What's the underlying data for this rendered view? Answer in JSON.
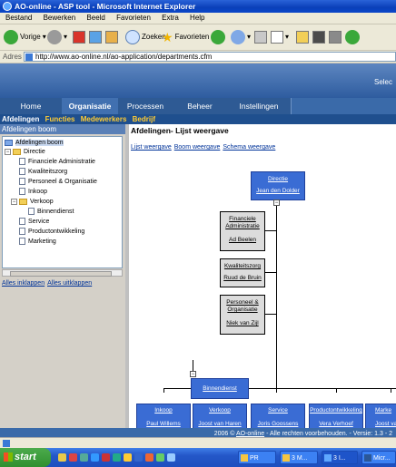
{
  "window": {
    "title": "AO-online - ASP tool - Microsoft Internet Explorer"
  },
  "menu": [
    "Bestand",
    "Bewerken",
    "Beeld",
    "Favorieten",
    "Extra",
    "Help"
  ],
  "toolbar": {
    "back": "Vorige",
    "search": "Zoeken",
    "favorites": "Favorieten"
  },
  "address": {
    "label": "Adres",
    "url": "http://www.ao-online.nl/ao-application/departments.cfm"
  },
  "banner": {
    "right_text": "Selec"
  },
  "nav": {
    "tabs": [
      "Home",
      "Organisatie",
      "Processen",
      "Beheer",
      "Instellingen"
    ],
    "active": "Organisatie"
  },
  "subnav": [
    "Afdelingen",
    "Functies",
    "Medewerkers",
    "Bedrijf"
  ],
  "left": {
    "heading": "Afdelingen boom",
    "tree": {
      "root": "Afdelingen boom",
      "directie": "Directie",
      "fin": "Financiele Administratie",
      "kwal": "Kwaliteitszorg",
      "po": "Personeel & Organisatie",
      "inkoop": "Inkoop",
      "verkoop": "Verkoop",
      "binnendienst": "Binnendienst",
      "service": "Service",
      "productontwikkeling": "Productontwikkeling",
      "marketing": "Marketing"
    },
    "expand_all": "Alles inklappen",
    "collapse_all": "Alles uitklappen"
  },
  "content": {
    "title": "Afdelingen- Lijst weergave",
    "views": [
      "Lijst weergave",
      "Boom weergave",
      "Schema weergave"
    ]
  },
  "org": {
    "directie": {
      "name": "Directie",
      "person": "Jean den Dolder"
    },
    "fin": {
      "name": "Financiele Administratie",
      "person": "Ad Beelen"
    },
    "kwal": {
      "name": "Kwaliteitszorg",
      "person": "Ruud de Bruin"
    },
    "po": {
      "name": "Personeel & Organisatie",
      "person": "Niek van Zijl"
    },
    "inkoop": {
      "name": "Inkoop",
      "person": "Paul Willems"
    },
    "verkoop": {
      "name": "Verkoop",
      "person": "Joost van Haren"
    },
    "service": {
      "name": "Service",
      "person": "Joris Goossens"
    },
    "prod": {
      "name": "Productontwikkeling",
      "person": "Vera Verhoef"
    },
    "marketing": {
      "name": "Marke",
      "person": "Joost van"
    },
    "binnendienst": {
      "name": "Binnendienst"
    }
  },
  "footer": {
    "prefix": "2006 ©",
    "link": "AO-online",
    "suffix": "- Alle rechten voorbehouden. - Versie: 1.3 - 2"
  },
  "taskbar": {
    "start": "start",
    "tasks": [
      "PR",
      "3 M...",
      "3 I...",
      "Micr..."
    ]
  }
}
